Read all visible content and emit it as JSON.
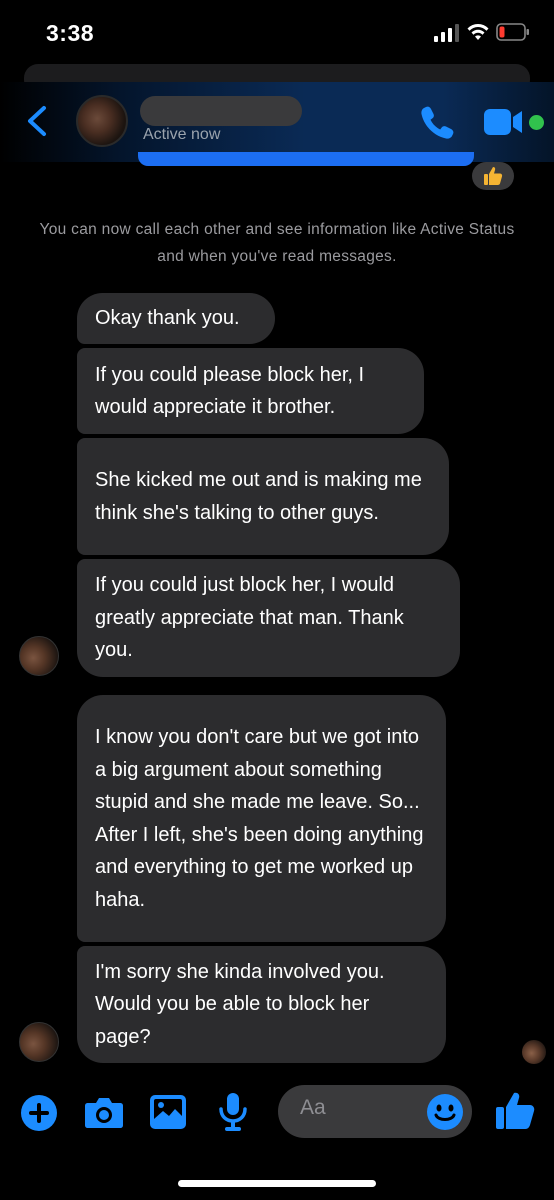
{
  "status_bar": {
    "time": "3:38"
  },
  "header": {
    "status": "Active now",
    "accent_color": "#1c8cff",
    "active_dot_color": "#31c24d"
  },
  "info": {
    "text": "You can now call each other and see information like Active Status and when you've read messages."
  },
  "messages": [
    {
      "text": "Okay thank you."
    },
    {
      "text": "If you could please block her, I would appreciate it brother."
    },
    {
      "text": "She kicked me out and is making me think she's talking to other guys."
    },
    {
      "text": "If you could just block her, I would greatly appreciate that man. Thank you."
    },
    {
      "text": "I know you don't care but we got into a big argument about something stupid and she made me leave. So... After I left, she's been doing anything and everything to get me worked up haha."
    },
    {
      "text": "I'm sorry she kinda involved you. Would you be able to block her page?"
    }
  ],
  "composer": {
    "placeholder": "Aa"
  },
  "icons": [
    "back-chevron-icon",
    "phone-icon",
    "video-camera-icon",
    "thumbs-up-icon",
    "plus-icon",
    "camera-icon",
    "photo-icon",
    "microphone-icon",
    "emoji-icon"
  ]
}
